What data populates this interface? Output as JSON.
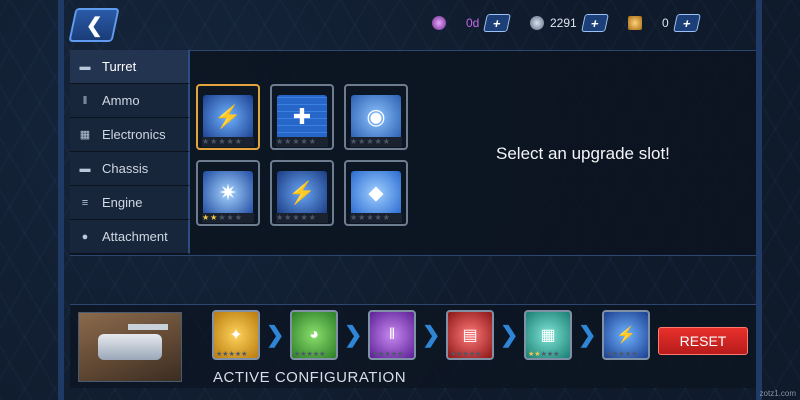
{
  "header": {
    "back_label": "❮",
    "currencies": [
      {
        "icon": "gem-icon",
        "value": "0d",
        "color": "#b84de0",
        "plus": "+"
      },
      {
        "icon": "coin-icon",
        "value": "2291",
        "color": "#9aa9bd",
        "plus": "+"
      },
      {
        "icon": "rank-wings-icon",
        "value": "0",
        "color": "#e0a33a",
        "plus": "+"
      }
    ]
  },
  "tabs": [
    {
      "label": "Turret",
      "icon": "turret-icon",
      "active": true
    },
    {
      "label": "Ammo",
      "icon": "ammo-icon",
      "active": false
    },
    {
      "label": "Electronics",
      "icon": "electronics-icon",
      "active": false
    },
    {
      "label": "Chassis",
      "icon": "chassis-icon",
      "active": false
    },
    {
      "label": "Engine",
      "icon": "engine-icon",
      "active": false
    },
    {
      "label": "Attachment",
      "icon": "attachment-icon",
      "active": false
    }
  ],
  "upgrade_slots": [
    {
      "icon": "electric-shell-icon",
      "stars": 0,
      "selected": true,
      "color": "#2a5bbf"
    },
    {
      "icon": "targeting-grid-icon",
      "stars": 0,
      "selected": false,
      "color": "#2766c9"
    },
    {
      "icon": "bullet-scope-icon",
      "stars": 0,
      "selected": false,
      "color": "#3a7fd6"
    },
    {
      "icon": "debris-blast-icon",
      "stars": 2,
      "selected": false,
      "color": "#2f6fd0"
    },
    {
      "icon": "tank-lightning-icon",
      "stars": 0,
      "selected": false,
      "color": "#2558b8"
    },
    {
      "icon": "shell-bracket-icon",
      "stars": 0,
      "selected": false,
      "color": "#2a74d8"
    }
  ],
  "select_message": "Select an upgrade slot!",
  "active_config": {
    "label": "ACTIVE CONFIGURATION",
    "items": [
      {
        "icon": "turret-upgrade-icon",
        "color": "#e0a520",
        "stars": 0
      },
      {
        "icon": "dome-shield-icon",
        "color": "#3fae3a",
        "stars": 0
      },
      {
        "icon": "dual-shell-icon",
        "color": "#8a3cc8",
        "stars": 0
      },
      {
        "icon": "tank-red-icon",
        "color": "#c42b2b",
        "stars": 0
      },
      {
        "icon": "engine-block-icon",
        "color": "#2aa89a",
        "stars": 2
      },
      {
        "icon": "electric-shell-icon",
        "color": "#2a5bbf",
        "stars": 0
      }
    ]
  },
  "reset_label": "RESET",
  "watermark": "zotz1.com"
}
